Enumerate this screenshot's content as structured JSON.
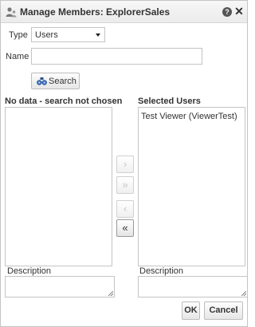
{
  "dialog": {
    "title": "Manage Members: ExplorerSales",
    "help_icon": "help-icon",
    "close_icon": "close-icon",
    "help_glyph": "?",
    "close_glyph": "✕"
  },
  "form": {
    "type_label": "Type",
    "type_value": "Users",
    "name_label": "Name",
    "name_value": "",
    "search_label": "Search"
  },
  "available": {
    "heading": "No data - search not chosen",
    "items": [],
    "description_label": "Description"
  },
  "selected": {
    "heading": "Selected Users",
    "items": [
      "Test Viewer (ViewerTest)"
    ],
    "description_label": "Description"
  },
  "shuttle": {
    "move_right": "›",
    "move_all_right": "»",
    "move_left": "‹",
    "move_all_left": "«"
  },
  "footer": {
    "ok_label": "OK",
    "cancel_label": "Cancel"
  },
  "colors": {
    "title_bar": "#ebebeb",
    "border": "#c4c4c4",
    "text": "#333333"
  }
}
